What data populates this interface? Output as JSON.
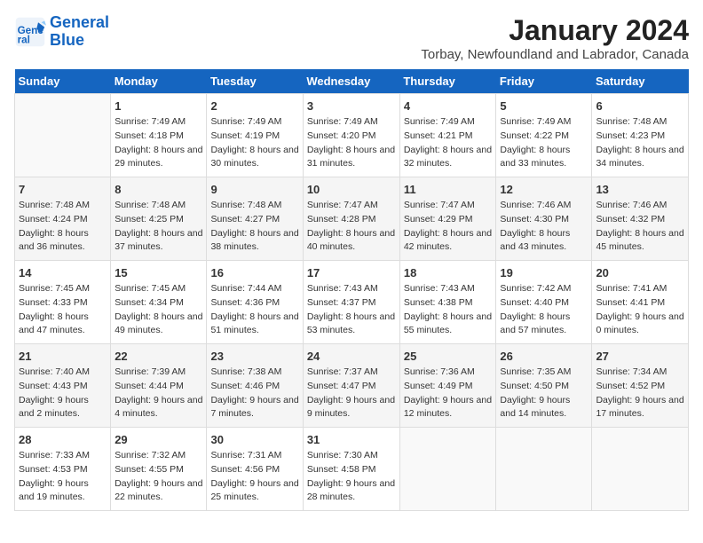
{
  "logo": {
    "line1": "General",
    "line2": "Blue"
  },
  "title": "January 2024",
  "subtitle": "Torbay, Newfoundland and Labrador, Canada",
  "days_of_week": [
    "Sunday",
    "Monday",
    "Tuesday",
    "Wednesday",
    "Thursday",
    "Friday",
    "Saturday"
  ],
  "weeks": [
    [
      {
        "day": "",
        "sunrise": "",
        "sunset": "",
        "daylight": ""
      },
      {
        "day": "1",
        "sunrise": "Sunrise: 7:49 AM",
        "sunset": "Sunset: 4:18 PM",
        "daylight": "Daylight: 8 hours and 29 minutes."
      },
      {
        "day": "2",
        "sunrise": "Sunrise: 7:49 AM",
        "sunset": "Sunset: 4:19 PM",
        "daylight": "Daylight: 8 hours and 30 minutes."
      },
      {
        "day": "3",
        "sunrise": "Sunrise: 7:49 AM",
        "sunset": "Sunset: 4:20 PM",
        "daylight": "Daylight: 8 hours and 31 minutes."
      },
      {
        "day": "4",
        "sunrise": "Sunrise: 7:49 AM",
        "sunset": "Sunset: 4:21 PM",
        "daylight": "Daylight: 8 hours and 32 minutes."
      },
      {
        "day": "5",
        "sunrise": "Sunrise: 7:49 AM",
        "sunset": "Sunset: 4:22 PM",
        "daylight": "Daylight: 8 hours and 33 minutes."
      },
      {
        "day": "6",
        "sunrise": "Sunrise: 7:48 AM",
        "sunset": "Sunset: 4:23 PM",
        "daylight": "Daylight: 8 hours and 34 minutes."
      }
    ],
    [
      {
        "day": "7",
        "sunrise": "Sunrise: 7:48 AM",
        "sunset": "Sunset: 4:24 PM",
        "daylight": "Daylight: 8 hours and 36 minutes."
      },
      {
        "day": "8",
        "sunrise": "Sunrise: 7:48 AM",
        "sunset": "Sunset: 4:25 PM",
        "daylight": "Daylight: 8 hours and 37 minutes."
      },
      {
        "day": "9",
        "sunrise": "Sunrise: 7:48 AM",
        "sunset": "Sunset: 4:27 PM",
        "daylight": "Daylight: 8 hours and 38 minutes."
      },
      {
        "day": "10",
        "sunrise": "Sunrise: 7:47 AM",
        "sunset": "Sunset: 4:28 PM",
        "daylight": "Daylight: 8 hours and 40 minutes."
      },
      {
        "day": "11",
        "sunrise": "Sunrise: 7:47 AM",
        "sunset": "Sunset: 4:29 PM",
        "daylight": "Daylight: 8 hours and 42 minutes."
      },
      {
        "day": "12",
        "sunrise": "Sunrise: 7:46 AM",
        "sunset": "Sunset: 4:30 PM",
        "daylight": "Daylight: 8 hours and 43 minutes."
      },
      {
        "day": "13",
        "sunrise": "Sunrise: 7:46 AM",
        "sunset": "Sunset: 4:32 PM",
        "daylight": "Daylight: 8 hours and 45 minutes."
      }
    ],
    [
      {
        "day": "14",
        "sunrise": "Sunrise: 7:45 AM",
        "sunset": "Sunset: 4:33 PM",
        "daylight": "Daylight: 8 hours and 47 minutes."
      },
      {
        "day": "15",
        "sunrise": "Sunrise: 7:45 AM",
        "sunset": "Sunset: 4:34 PM",
        "daylight": "Daylight: 8 hours and 49 minutes."
      },
      {
        "day": "16",
        "sunrise": "Sunrise: 7:44 AM",
        "sunset": "Sunset: 4:36 PM",
        "daylight": "Daylight: 8 hours and 51 minutes."
      },
      {
        "day": "17",
        "sunrise": "Sunrise: 7:43 AM",
        "sunset": "Sunset: 4:37 PM",
        "daylight": "Daylight: 8 hours and 53 minutes."
      },
      {
        "day": "18",
        "sunrise": "Sunrise: 7:43 AM",
        "sunset": "Sunset: 4:38 PM",
        "daylight": "Daylight: 8 hours and 55 minutes."
      },
      {
        "day": "19",
        "sunrise": "Sunrise: 7:42 AM",
        "sunset": "Sunset: 4:40 PM",
        "daylight": "Daylight: 8 hours and 57 minutes."
      },
      {
        "day": "20",
        "sunrise": "Sunrise: 7:41 AM",
        "sunset": "Sunset: 4:41 PM",
        "daylight": "Daylight: 9 hours and 0 minutes."
      }
    ],
    [
      {
        "day": "21",
        "sunrise": "Sunrise: 7:40 AM",
        "sunset": "Sunset: 4:43 PM",
        "daylight": "Daylight: 9 hours and 2 minutes."
      },
      {
        "day": "22",
        "sunrise": "Sunrise: 7:39 AM",
        "sunset": "Sunset: 4:44 PM",
        "daylight": "Daylight: 9 hours and 4 minutes."
      },
      {
        "day": "23",
        "sunrise": "Sunrise: 7:38 AM",
        "sunset": "Sunset: 4:46 PM",
        "daylight": "Daylight: 9 hours and 7 minutes."
      },
      {
        "day": "24",
        "sunrise": "Sunrise: 7:37 AM",
        "sunset": "Sunset: 4:47 PM",
        "daylight": "Daylight: 9 hours and 9 minutes."
      },
      {
        "day": "25",
        "sunrise": "Sunrise: 7:36 AM",
        "sunset": "Sunset: 4:49 PM",
        "daylight": "Daylight: 9 hours and 12 minutes."
      },
      {
        "day": "26",
        "sunrise": "Sunrise: 7:35 AM",
        "sunset": "Sunset: 4:50 PM",
        "daylight": "Daylight: 9 hours and 14 minutes."
      },
      {
        "day": "27",
        "sunrise": "Sunrise: 7:34 AM",
        "sunset": "Sunset: 4:52 PM",
        "daylight": "Daylight: 9 hours and 17 minutes."
      }
    ],
    [
      {
        "day": "28",
        "sunrise": "Sunrise: 7:33 AM",
        "sunset": "Sunset: 4:53 PM",
        "daylight": "Daylight: 9 hours and 19 minutes."
      },
      {
        "day": "29",
        "sunrise": "Sunrise: 7:32 AM",
        "sunset": "Sunset: 4:55 PM",
        "daylight": "Daylight: 9 hours and 22 minutes."
      },
      {
        "day": "30",
        "sunrise": "Sunrise: 7:31 AM",
        "sunset": "Sunset: 4:56 PM",
        "daylight": "Daylight: 9 hours and 25 minutes."
      },
      {
        "day": "31",
        "sunrise": "Sunrise: 7:30 AM",
        "sunset": "Sunset: 4:58 PM",
        "daylight": "Daylight: 9 hours and 28 minutes."
      },
      {
        "day": "",
        "sunrise": "",
        "sunset": "",
        "daylight": ""
      },
      {
        "day": "",
        "sunrise": "",
        "sunset": "",
        "daylight": ""
      },
      {
        "day": "",
        "sunrise": "",
        "sunset": "",
        "daylight": ""
      }
    ]
  ]
}
